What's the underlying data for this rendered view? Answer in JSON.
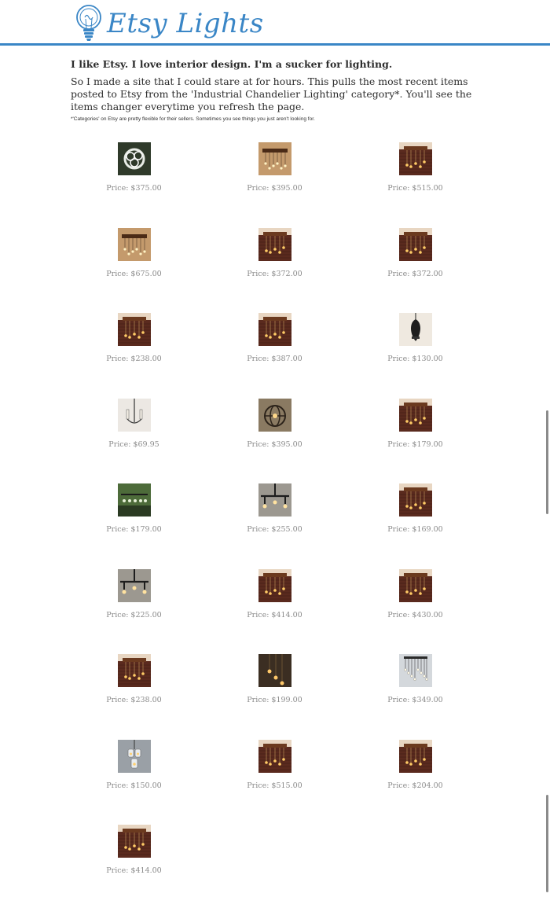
{
  "header": {
    "logo_text": "Etsy Lights",
    "brand_color": "#3a86c6",
    "logo_icon": "lightbulb-icon"
  },
  "intro": {
    "lead": "I like Etsy. I love interior design. I'm a sucker for lighting.",
    "body": "So I made a site that I could stare at for hours. This pulls the most recent items posted to Etsy from the 'Industrial Chandelier Lighting' category*. You'll see the items changer everytime you refresh the page.",
    "footnote": "*'Categories' on Etsy are pretty flexible for their sellers. Sometimes you see things you just aren't looking for."
  },
  "items": [
    {
      "price": "Price: $375.00",
      "style": "wreath"
    },
    {
      "price": "Price: $395.00",
      "style": "warm"
    },
    {
      "price": "Price: $515.00",
      "style": "brick"
    },
    {
      "price": "Price: $675.00",
      "style": "warm"
    },
    {
      "price": "Price: $372.00",
      "style": "brick"
    },
    {
      "price": "Price: $372.00",
      "style": "brick"
    },
    {
      "price": "Price: $238.00",
      "style": "brick"
    },
    {
      "price": "Price: $387.00",
      "style": "brick"
    },
    {
      "price": "Price: $130.00",
      "style": "pendant"
    },
    {
      "price": "Price: $69.95",
      "style": "sconce"
    },
    {
      "price": "Price: $395.00",
      "style": "orb"
    },
    {
      "price": "Price: $179.00",
      "style": "brick"
    },
    {
      "price": "Price: $179.00",
      "style": "green"
    },
    {
      "price": "Price: $255.00",
      "style": "pipe"
    },
    {
      "price": "Price: $169.00",
      "style": "brick"
    },
    {
      "price": "Price: $225.00",
      "style": "pipe"
    },
    {
      "price": "Price: $414.00",
      "style": "brick"
    },
    {
      "price": "Price: $430.00",
      "style": "brick"
    },
    {
      "price": "Price: $238.00",
      "style": "brick"
    },
    {
      "price": "Price: $199.00",
      "style": "dark"
    },
    {
      "price": "Price: $349.00",
      "style": "hanging"
    },
    {
      "price": "Price: $150.00",
      "style": "jar"
    },
    {
      "price": "Price: $515.00",
      "style": "brick"
    },
    {
      "price": "Price: $204.00",
      "style": "brick"
    },
    {
      "price": "Price: $414.00",
      "style": "brick"
    }
  ]
}
